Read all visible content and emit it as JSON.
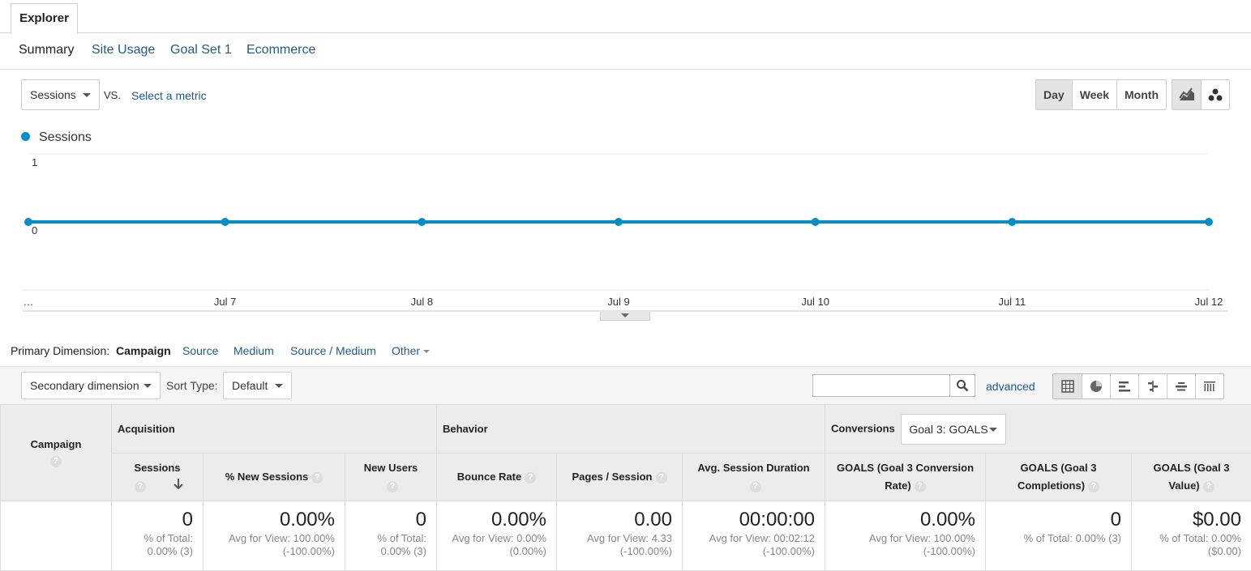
{
  "tab": {
    "label": "Explorer"
  },
  "subnav": {
    "summary": "Summary",
    "site_usage": "Site Usage",
    "goal_set": "Goal Set 1",
    "ecommerce": "Ecommerce"
  },
  "controls": {
    "metric_select": "Sessions",
    "vs": "VS.",
    "select_metric": "Select a metric",
    "periods": [
      "Day",
      "Week",
      "Month"
    ],
    "active_period": "Day",
    "chart_type_icons": [
      "line-chart-icon",
      "motion-chart-icon"
    ]
  },
  "chart_data": {
    "type": "line",
    "series": [
      {
        "name": "Sessions",
        "color": "#058dc7",
        "values": [
          0,
          0,
          0,
          0,
          0,
          0,
          0
        ]
      }
    ],
    "x": [
      "…",
      "Jul 7",
      "Jul 8",
      "Jul 9",
      "Jul 10",
      "Jul 11",
      "Jul 12"
    ],
    "xtick_labels": [
      "…",
      "Jul 7",
      "Jul 8",
      "Jul 9",
      "Jul 10",
      "Jul 11",
      "Jul 12"
    ],
    "ytick_labels": [
      "1",
      "0"
    ],
    "ylim": [
      -1,
      1
    ],
    "grid": true,
    "legend": "top-left"
  },
  "dimension": {
    "label": "Primary Dimension:",
    "active": "Campaign",
    "links": [
      "Source",
      "Medium",
      "Source / Medium",
      "Other"
    ]
  },
  "toolbar": {
    "secondary": "Secondary dimension",
    "sort_label": "Sort Type:",
    "sort_value": "Default",
    "search_placeholder": "",
    "advanced": "advanced",
    "view_icons": [
      "data-table-icon",
      "pie-chart-icon",
      "performance-bar-icon",
      "comparison-icon",
      "term-cloud-icon",
      "pivot-icon"
    ]
  },
  "table": {
    "groups": {
      "campaign": "Campaign",
      "acquisition": "Acquisition",
      "behavior": "Behavior",
      "conversions": "Conversions",
      "goal_select": "Goal 3: GOALS"
    },
    "columns": [
      "Sessions",
      "% New Sessions",
      "New Users",
      "Bounce Rate",
      "Pages / Session",
      "Avg. Session Duration",
      "GOALS (Goal 3 Conversion Rate)",
      "GOALS (Goal 3 Completions)",
      "GOALS (Goal 3 Value)"
    ],
    "totals": [
      {
        "value": "0",
        "l1": "% of Total:",
        "l2": "0.00% (3)"
      },
      {
        "value": "0.00%",
        "l1": "Avg for View: 100.00%",
        "l2": "(-100.00%)"
      },
      {
        "value": "0",
        "l1": "% of Total:",
        "l2": "0.00% (3)"
      },
      {
        "value": "0.00%",
        "l1": "Avg for View: 0.00%",
        "l2": "(0.00%)"
      },
      {
        "value": "0.00",
        "l1": "Avg for View: 4.33",
        "l2": "(-100.00%)"
      },
      {
        "value": "00:00:00",
        "l1": "Avg for View: 00:02:12",
        "l2": "(-100.00%)"
      },
      {
        "value": "0.00%",
        "l1": "Avg for View: 100.00%",
        "l2": "(-100.00%)"
      },
      {
        "value": "0",
        "l1": "% of Total: 0.00% (3)",
        "l2": ""
      },
      {
        "value": "$0.00",
        "l1": "% of Total: 0.00%",
        "l2": "($0.00)"
      }
    ]
  }
}
